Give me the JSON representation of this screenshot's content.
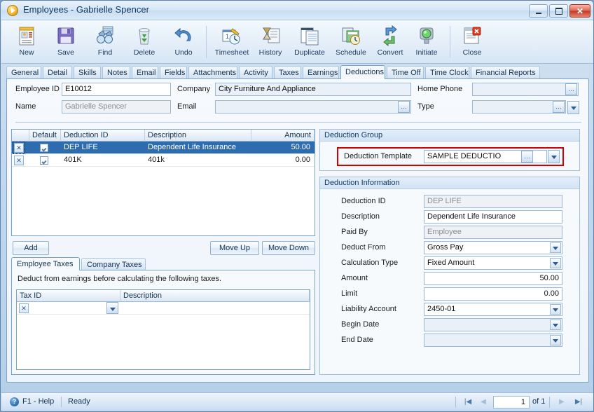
{
  "window": {
    "title": "Employees - Gabrielle Spencer",
    "icon": "app-play-icon",
    "controls": {
      "minimize": "Minimize",
      "maximize": "Maximize",
      "close": "Close"
    }
  },
  "toolbar": {
    "buttons": [
      {
        "label": "New",
        "icon": "new-document-icon"
      },
      {
        "label": "Save",
        "icon": "floppy-disk-icon"
      },
      {
        "label": "Find",
        "icon": "binoculars-icon"
      },
      {
        "label": "Delete",
        "icon": "recycle-bin-icon"
      },
      {
        "label": "Undo",
        "icon": "undo-arrow-icon"
      },
      {
        "label": "Timesheet",
        "icon": "timesheet-clock-icon"
      },
      {
        "label": "History",
        "icon": "hourglass-history-icon"
      },
      {
        "label": "Duplicate",
        "icon": "duplicate-pages-icon"
      },
      {
        "label": "Schedule",
        "icon": "schedule-calendar-icon"
      },
      {
        "label": "Convert",
        "icon": "convert-arrows-icon"
      },
      {
        "label": "Initiate",
        "icon": "initiate-light-icon"
      },
      {
        "label": "Close",
        "icon": "close-document-icon"
      }
    ]
  },
  "tabs": [
    {
      "label": "General",
      "active": false
    },
    {
      "label": "Detail",
      "active": false
    },
    {
      "label": "Skills",
      "active": false
    },
    {
      "label": "Notes",
      "active": false
    },
    {
      "label": "Email",
      "active": false
    },
    {
      "label": "Fields",
      "active": false
    },
    {
      "label": "Attachments",
      "active": false
    },
    {
      "label": "Activity",
      "active": false
    },
    {
      "label": "Taxes",
      "active": false
    },
    {
      "label": "Earnings",
      "active": false
    },
    {
      "label": "Deductions",
      "active": true
    },
    {
      "label": "Time Off",
      "active": false
    },
    {
      "label": "Time Clock",
      "active": false
    },
    {
      "label": "Financial Reports",
      "active": false
    }
  ],
  "header_fields": {
    "employee_id_label": "Employee ID",
    "employee_id_value": "E10012",
    "name_label": "Name",
    "name_value": "Gabrielle Spencer",
    "company_label": "Company",
    "company_value": "City Furniture And Appliance",
    "email_label": "Email",
    "email_value": "",
    "home_phone_label": "Home Phone",
    "home_phone_value": "",
    "type_label": "Type",
    "type_value": ""
  },
  "deduction_grid": {
    "columns": [
      "",
      "Default",
      "Deduction ID",
      "Description",
      "Amount"
    ],
    "rows": [
      {
        "default": true,
        "deduction_id": "DEP LIFE",
        "description": "Dependent Life Insurance",
        "amount": "50.00",
        "selected": true
      },
      {
        "default": true,
        "deduction_id": "401K",
        "description": "401k",
        "amount": "0.00",
        "selected": false
      }
    ]
  },
  "grid_buttons": {
    "add": "Add",
    "move_up": "Move Up",
    "move_down": "Move Down"
  },
  "tax_section": {
    "tabs": [
      {
        "label": "Employee Taxes",
        "active": true
      },
      {
        "label": "Company Taxes",
        "active": false
      }
    ],
    "instruction": "Deduct from earnings before calculating the following taxes.",
    "columns": [
      "Tax ID",
      "Description"
    ],
    "rows": [
      {
        "tax_id": "",
        "description": ""
      }
    ]
  },
  "deduction_group": {
    "title": "Deduction Group",
    "template_label": "Deduction Template",
    "template_value": "SAMPLE DEDUCTIO",
    "highlight_color": "#d60000"
  },
  "deduction_information": {
    "title": "Deduction Information",
    "fields": [
      {
        "label": "Deduction ID",
        "value": "DEP LIFE",
        "kind": "readonly"
      },
      {
        "label": "Description",
        "value": "Dependent Life Insurance",
        "kind": "text"
      },
      {
        "label": "Paid By",
        "value": "Employee",
        "kind": "readonly"
      },
      {
        "label": "Deduct From",
        "value": "Gross Pay",
        "kind": "combo"
      },
      {
        "label": "Calculation Type",
        "value": "Fixed Amount",
        "kind": "combo"
      },
      {
        "label": "Amount",
        "value": "50.00",
        "kind": "number"
      },
      {
        "label": "Limit",
        "value": "0.00",
        "kind": "number"
      },
      {
        "label": "Liability Account",
        "value": "2450-01",
        "kind": "combo"
      },
      {
        "label": "Begin Date",
        "value": "",
        "kind": "combo"
      },
      {
        "label": "End Date",
        "value": "",
        "kind": "combo"
      }
    ]
  },
  "statusbar": {
    "help": "F1 - Help",
    "status": "Ready",
    "page_current": "1",
    "page_of": "of 1",
    "nav": {
      "first": "first-record",
      "previous": "previous-record",
      "next": "next-record",
      "last": "last-record"
    }
  }
}
